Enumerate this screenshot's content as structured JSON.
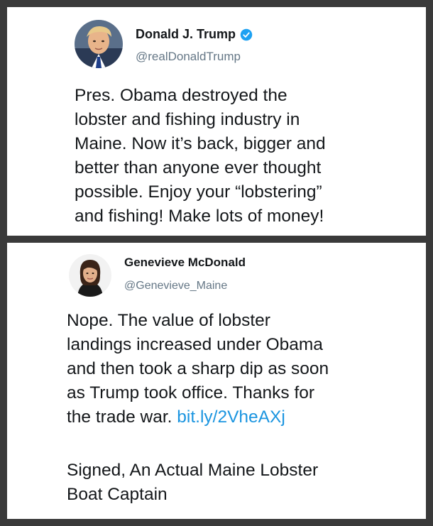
{
  "tweets": [
    {
      "name": "Donald J. Trump",
      "handle": "@realDonaldTrump",
      "verified": true,
      "avatar_icon": "person-portrait-icon",
      "text": "Pres. Obama destroyed the\nlobster and fishing industry in\nMaine. Now it’s back, bigger and\nbetter than anyone ever thought\npossible. Enjoy your “lobstering”\nand fishing! Make lots of money!"
    },
    {
      "name": "Genevieve McDonald",
      "handle": "@Genevieve_Maine",
      "verified": false,
      "avatar_icon": "person-portrait-icon",
      "text": "Nope. The value of lobster\nlandings increased under Obama\nand then took a sharp dip as soon\nas Trump took office. Thanks for\nthe trade war. ",
      "link": "bit.ly/2VheAXj",
      "signoff": "Signed, An Actual Maine Lobster\nBoat Captain"
    }
  ],
  "colors": {
    "background": "#3a3a3a",
    "card": "#ffffff",
    "text": "#14171a",
    "handle": "#657786",
    "link": "#1b95e0",
    "verified": "#1da1f2"
  }
}
